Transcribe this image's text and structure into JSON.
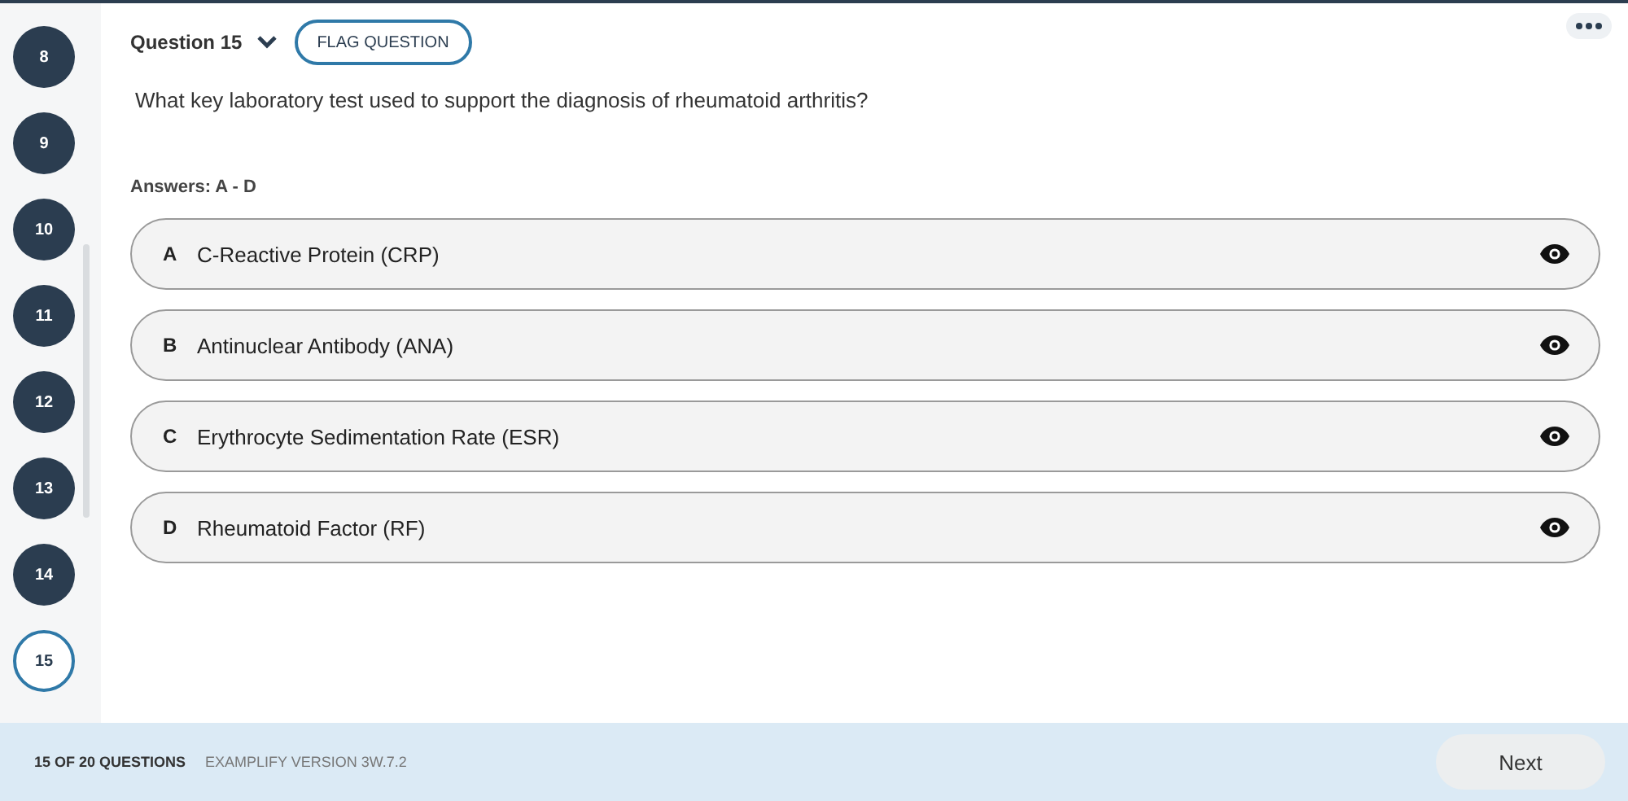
{
  "sidebar": {
    "items": [
      {
        "label": "8",
        "selected": false
      },
      {
        "label": "9",
        "selected": false
      },
      {
        "label": "10",
        "selected": false
      },
      {
        "label": "11",
        "selected": false
      },
      {
        "label": "12",
        "selected": false
      },
      {
        "label": "13",
        "selected": false
      },
      {
        "label": "14",
        "selected": false
      },
      {
        "label": "15",
        "selected": true
      }
    ]
  },
  "header": {
    "question_label": "Question 15",
    "flag_button": "FLAG QUESTION"
  },
  "question": "What key laboratory test used to support the diagnosis of rheumatoid arthritis?",
  "answers_label": "Answers: A - D",
  "answers": [
    {
      "letter": "A",
      "text": "C-Reactive Protein (CRP)"
    },
    {
      "letter": "B",
      "text": "Antinuclear Antibody (ANA)"
    },
    {
      "letter": "C",
      "text": "Erythrocyte Sedimentation Rate (ESR)"
    },
    {
      "letter": "D",
      "text": "Rheumatoid Factor (RF)"
    }
  ],
  "status_bar": {
    "progress": "15 OF 20 QUESTIONS",
    "version": "EXAMPLIFY VERSION 3W.7.2",
    "next_button": "Next"
  }
}
